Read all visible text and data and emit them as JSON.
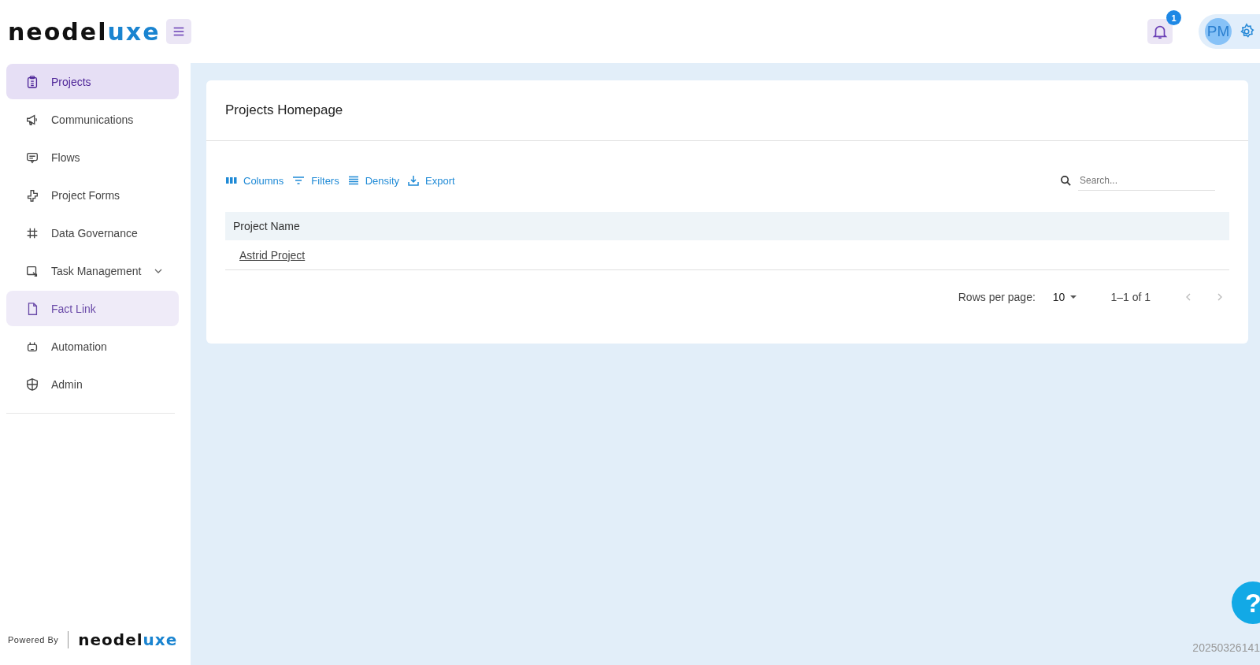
{
  "header": {
    "logo": {
      "text": "neodel",
      "accent": "uxe"
    },
    "notifications": {
      "count": "1"
    },
    "avatar": {
      "initials": "PM"
    }
  },
  "sidebar": {
    "items": [
      {
        "label": "Projects",
        "selected": true,
        "hovered": false,
        "expandable": false
      },
      {
        "label": "Communications",
        "selected": false,
        "hovered": false,
        "expandable": false
      },
      {
        "label": "Flows",
        "selected": false,
        "hovered": false,
        "expandable": false
      },
      {
        "label": "Project Forms",
        "selected": false,
        "hovered": false,
        "expandable": false
      },
      {
        "label": "Data Governance",
        "selected": false,
        "hovered": false,
        "expandable": false
      },
      {
        "label": "Task Management",
        "selected": false,
        "hovered": false,
        "expandable": true
      },
      {
        "label": "Fact Link",
        "selected": false,
        "hovered": true,
        "expandable": false
      },
      {
        "label": "Automation",
        "selected": false,
        "hovered": false,
        "expandable": false
      },
      {
        "label": "Admin",
        "selected": false,
        "hovered": false,
        "expandable": false
      }
    ],
    "footer": {
      "powered_by": "Powered By",
      "logo": {
        "text": "neodel",
        "accent": "uxe"
      }
    }
  },
  "card": {
    "title": "Projects Homepage",
    "toolbar": [
      {
        "kind": "columns",
        "label": "Columns"
      },
      {
        "kind": "filters",
        "label": "Filters"
      },
      {
        "kind": "density",
        "label": "Density"
      },
      {
        "kind": "export",
        "label": "Export"
      }
    ],
    "search": {
      "placeholder": "Search..."
    },
    "table": {
      "columns": [
        "Project Name"
      ],
      "rows": [
        [
          "Astrid Project"
        ]
      ]
    },
    "pagination": {
      "rows_per_page_label": "Rows per page:",
      "rows_per_page": "10",
      "range": "1–1 of 1"
    }
  },
  "help": {
    "label": "?"
  },
  "build_stamp": "20250326141"
}
